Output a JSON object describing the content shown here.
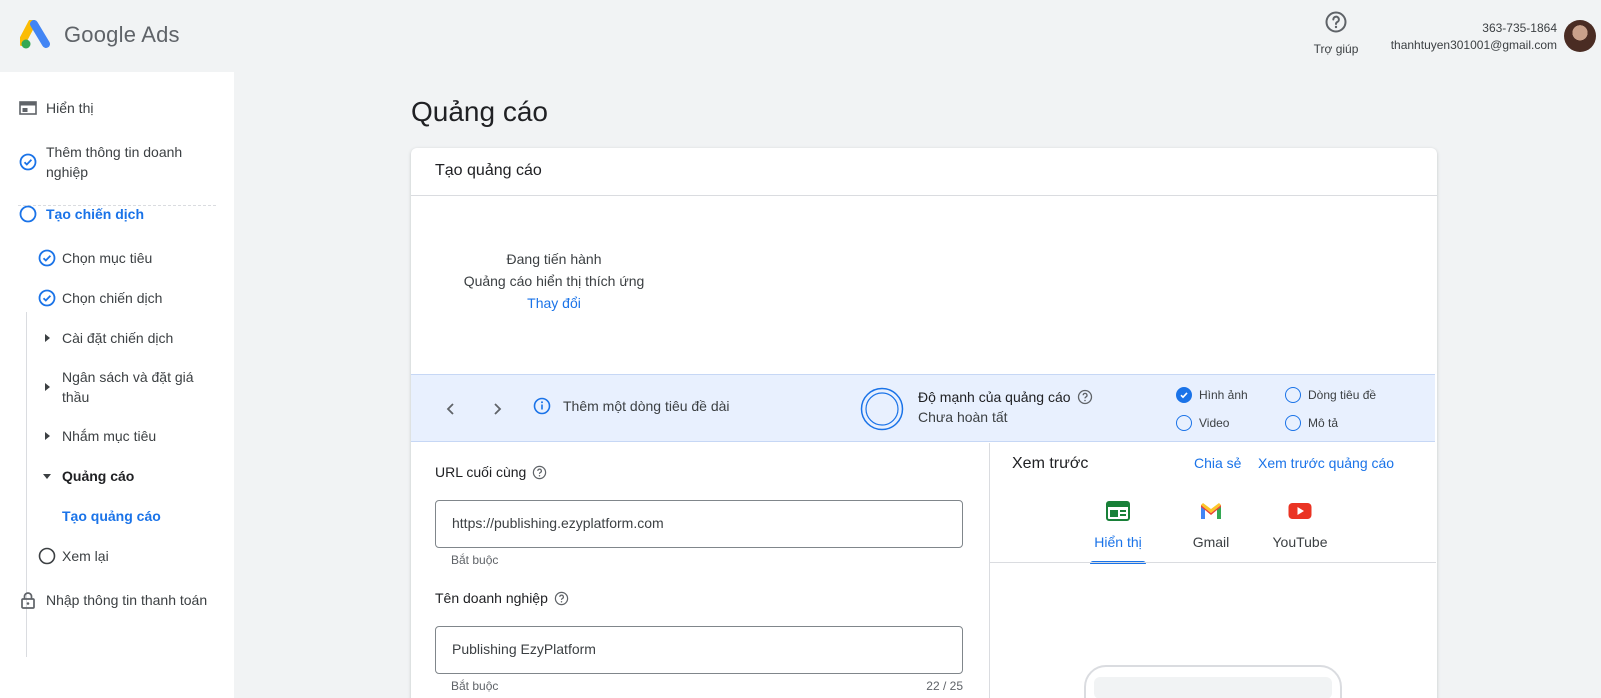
{
  "header": {
    "logo_text": "Google Ads",
    "help_label": "Trợ giúp",
    "account_id": "363-735-1864",
    "account_email": "thanhtuyen301001@gmail.com"
  },
  "sidebar": {
    "items": [
      {
        "label": "Hiển thị",
        "icon": "display-icon"
      },
      {
        "label": "Thêm thông tin doanh nghiệp",
        "icon": "check-circle-icon"
      },
      {
        "label": "Tạo chiến dịch",
        "icon": "circle-outline-icon"
      },
      {
        "label": "Chọn mục tiêu",
        "icon": "check-circle-icon"
      },
      {
        "label": "Chọn chiến dịch",
        "icon": "check-circle-icon"
      },
      {
        "label": "Cài đặt chiến dịch",
        "icon": "caret-right-icon"
      },
      {
        "label": "Ngân sách và đặt giá thầu",
        "icon": "caret-right-icon"
      },
      {
        "label": "Nhắm mục tiêu",
        "icon": "caret-right-icon"
      },
      {
        "label": "Quảng cáo",
        "icon": "caret-down-icon"
      },
      {
        "label": "Tạo quảng cáo",
        "icon": ""
      },
      {
        "label": "Xem lại",
        "icon": "circle-outline-icon"
      },
      {
        "label": "Nhập thông tin thanh toán",
        "icon": "lock-icon"
      }
    ]
  },
  "main": {
    "page_title": "Quảng cáo",
    "card_title": "Tạo quảng cáo",
    "status": {
      "line1": "Đang tiến hành",
      "line2": "Quảng cáo hiển thị thích ứng",
      "change_link": "Thay đổi"
    },
    "strength": {
      "tip": "Thêm một dòng tiêu đề dài",
      "title": "Độ mạnh của quảng cáo",
      "subtitle": "Chưa hoàn tất",
      "checks": [
        {
          "label": "Hình ảnh",
          "checked": true
        },
        {
          "label": "Dòng tiêu đề",
          "checked": false
        },
        {
          "label": "Video",
          "checked": false
        },
        {
          "label": "Mô tả",
          "checked": false
        }
      ]
    },
    "fields": {
      "url_label": "URL cuối cùng",
      "url_value": "https://publishing.ezyplatform.com",
      "url_helper": "Bắt buộc",
      "business_label": "Tên doanh nghiệp",
      "business_value": "Publishing EzyPlatform",
      "business_helper": "Bắt buộc",
      "business_counter": "22 / 25"
    },
    "preview": {
      "title": "Xem trước",
      "share_link": "Chia sẻ",
      "preview_link": "Xem trước quảng cáo",
      "tabs": [
        {
          "label": "Hiển thị",
          "active": true
        },
        {
          "label": "Gmail",
          "active": false
        },
        {
          "label": "YouTube",
          "active": false
        }
      ]
    }
  },
  "colors": {
    "accent": "#1a73e8",
    "strength_bg": "#e8f0fe",
    "youtube_red": "#ea3323",
    "display_green": "#188038"
  }
}
